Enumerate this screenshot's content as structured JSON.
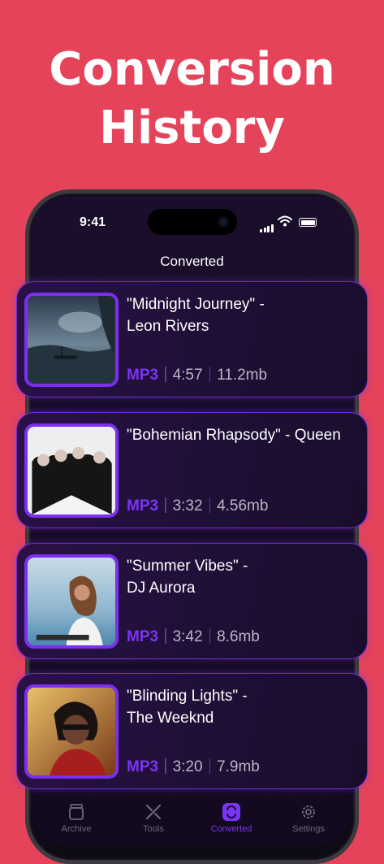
{
  "headline": {
    "line1": "Conversion",
    "line2": "History"
  },
  "status_bar": {
    "time": "9:41"
  },
  "nav": {
    "title": "Converted"
  },
  "items": [
    {
      "title_line1": "\"Midnight Journey\" -",
      "title_line2": "Leon Rivers",
      "format": "MP3",
      "duration": "4:57",
      "size": "11.2mb",
      "art_icon": "night-lake-boat-image"
    },
    {
      "title_line1": "\"Bohemian Rhapsody\" - Queen",
      "title_line2": "",
      "format": "MP3",
      "duration": "3:32",
      "size": "4.56mb",
      "art_icon": "queen-album-cover-image"
    },
    {
      "title_line1": "\"Summer Vibes\" -",
      "title_line2": "DJ Aurora",
      "format": "MP3",
      "duration": "3:42",
      "size": "8.6mb",
      "art_icon": "dj-on-beach-image"
    },
    {
      "title_line1": "\"Blinding Lights\" -",
      "title_line2": "The Weeknd",
      "format": "MP3",
      "duration": "3:20",
      "size": "7.9mb",
      "art_icon": "weeknd-portrait-image"
    }
  ],
  "tabs": [
    {
      "label": "Archive",
      "icon": "jar-icon"
    },
    {
      "label": "Tools",
      "icon": "tools-icon"
    },
    {
      "label": "Converted",
      "icon": "convert-icon",
      "active": true
    },
    {
      "label": "Settings",
      "icon": "gear-icon"
    }
  ],
  "colors": {
    "background": "#e5435a",
    "accent": "#7a35f4",
    "card_border": "#6b2ed1"
  }
}
